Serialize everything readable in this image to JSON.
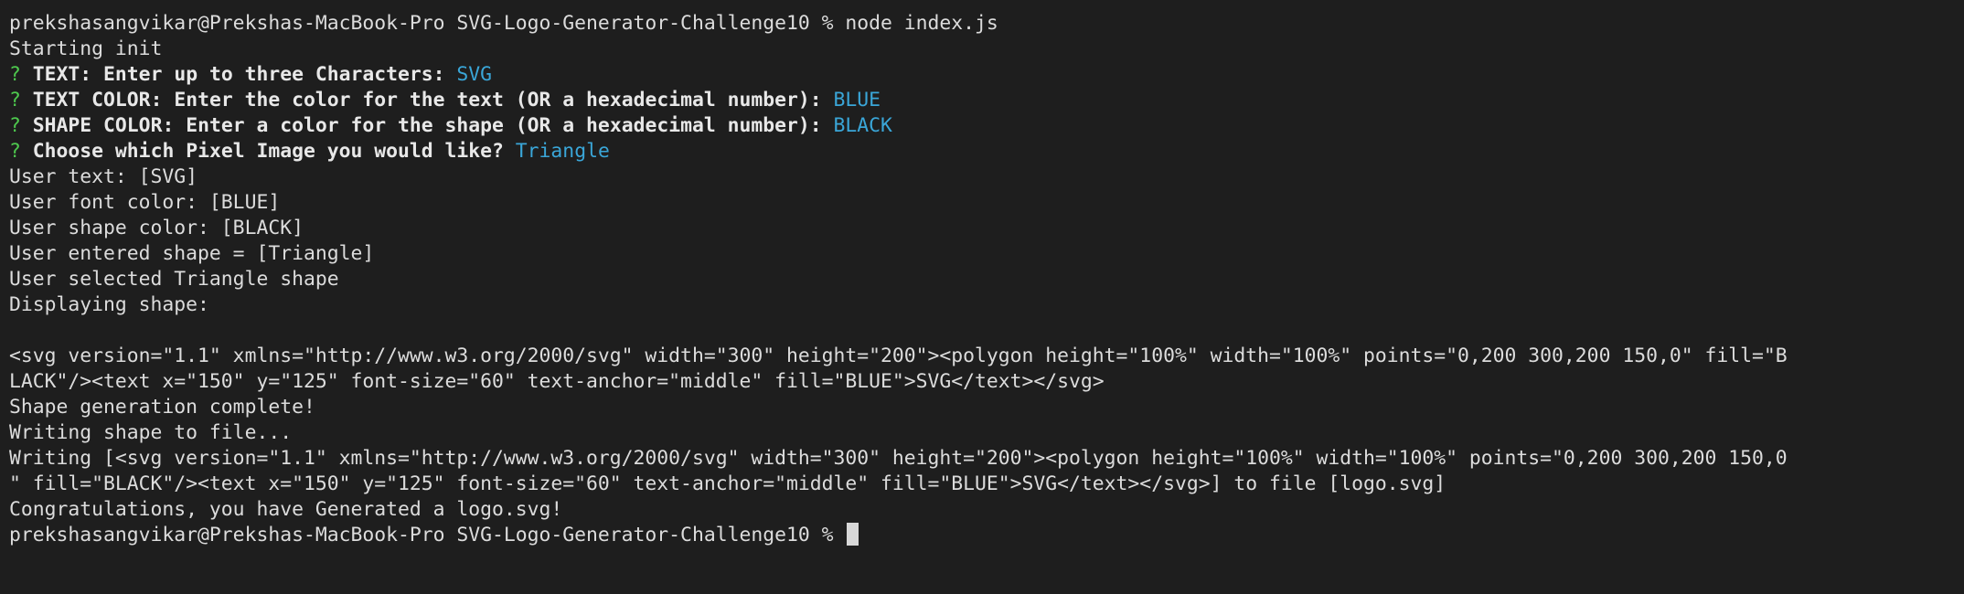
{
  "terminal": {
    "command_line": {
      "prompt": "prekshasangvikar@Prekshas-MacBook-Pro SVG-Logo-Generator-Challenge10 % ",
      "command": "node index.js"
    },
    "starting": "Starting init",
    "questions": [
      {
        "mark": "?",
        "question": "TEXT: Enter up to three Characters: ",
        "answer": "SVG"
      },
      {
        "mark": "?",
        "question": "TEXT COLOR: Enter the color for the text (OR a hexadecimal number): ",
        "answer": "BLUE"
      },
      {
        "mark": "?",
        "question": "SHAPE COLOR: Enter a color for the shape (OR a hexadecimal number): ",
        "answer": "BLACK"
      },
      {
        "mark": "?",
        "question": "Choose which Pixel Image you would like? ",
        "answer": "Triangle"
      }
    ],
    "log_lines": [
      "User text: [SVG]",
      "User font color: [BLUE]",
      "User shape color: [BLACK]",
      "User entered shape = [Triangle]",
      "User selected Triangle shape",
      "Displaying shape:"
    ],
    "blank": "",
    "svg_output": [
      "<svg version=\"1.1\" xmlns=\"http://www.w3.org/2000/svg\" width=\"300\" height=\"200\"><polygon height=\"100%\" width=\"100%\" points=\"0,200 300,200 150,0\" fill=\"B",
      "LACK\"/><text x=\"150\" y=\"125\" font-size=\"60\" text-anchor=\"middle\" fill=\"BLUE\">SVG</text></svg>"
    ],
    "post_lines": [
      "Shape generation complete!",
      "Writing shape to file..."
    ],
    "writing_output": [
      "Writing [<svg version=\"1.1\" xmlns=\"http://www.w3.org/2000/svg\" width=\"300\" height=\"200\"><polygon height=\"100%\" width=\"100%\" points=\"0,200 300,200 150,0",
      "\" fill=\"BLACK\"/><text x=\"150\" y=\"125\" font-size=\"60\" text-anchor=\"middle\" fill=\"BLUE\">SVG</text></svg>] to file [logo.svg]"
    ],
    "congrats": "Congratulations, you have Generated a logo.svg!",
    "final_prompt": "prekshasangvikar@Prekshas-MacBook-Pro SVG-Logo-Generator-Challenge10 % "
  }
}
